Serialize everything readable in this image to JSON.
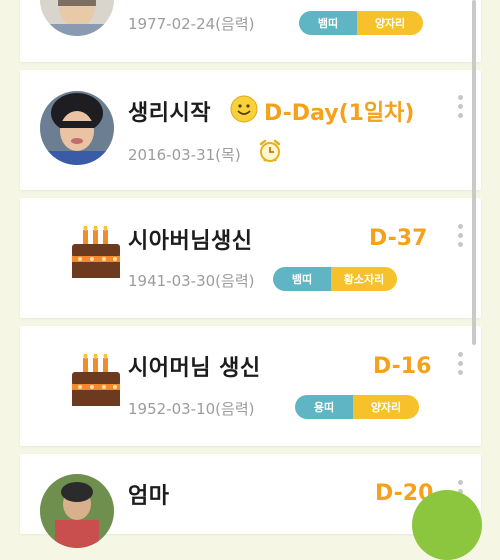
{
  "entries": [
    {
      "date": "1977-02-24(음력)",
      "zodiac": "뱀띠",
      "sign": "양자리"
    },
    {
      "title": "생리시작",
      "dday": "D-Day(1일차)",
      "date": "2016-03-31(목)",
      "icons": [
        "smiley-icon",
        "alarm-clock-icon"
      ]
    },
    {
      "title": "시아버님생신",
      "dday": "D-37",
      "date": "1941-03-30(음력)",
      "zodiac": "뱀띠",
      "sign": "황소자리"
    },
    {
      "title": "시어머님 생신",
      "dday": "D-16",
      "date": "1952-03-10(음력)",
      "zodiac": "용띠",
      "sign": "양자리"
    },
    {
      "title": "엄마",
      "dday": "D-20"
    }
  ],
  "colors": {
    "background": "#f5f7e4",
    "dday": "#f5a21a",
    "zodiac_pill": "#5fb5c4",
    "sign_pill": "#f7c12c",
    "fab": "#8cc63f"
  }
}
